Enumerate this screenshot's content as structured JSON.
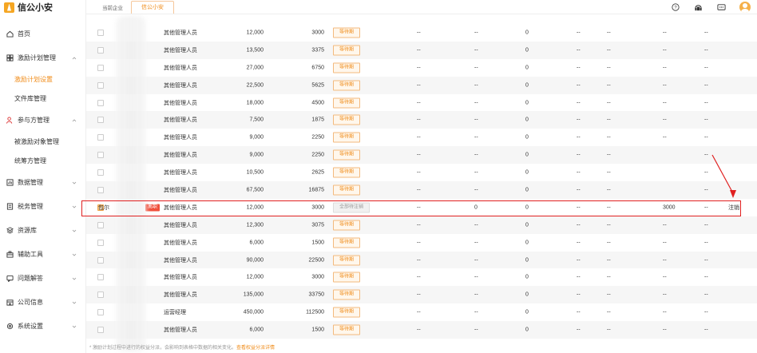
{
  "brand": {
    "name": "信公小安"
  },
  "header": {
    "company_label": "当前企业",
    "company_tab": "信公小安"
  },
  "sidebar": {
    "items": [
      {
        "label": "首页",
        "icon": "home-icon"
      },
      {
        "label": "激励计划管理",
        "icon": "chart-icon",
        "expanded": true,
        "children": [
          "激励计划设置",
          "文件库管理"
        ]
      },
      {
        "label": "参与方管理",
        "icon": "users-icon",
        "expanded": true,
        "children": [
          "被激励对象管理",
          "统筹方管理"
        ]
      },
      {
        "label": "数据管理",
        "icon": "database-icon"
      },
      {
        "label": "税务管理",
        "icon": "tax-icon"
      },
      {
        "label": "资源库",
        "icon": "resource-icon"
      },
      {
        "label": "辅助工具",
        "icon": "toolbox-icon"
      },
      {
        "label": "问题解答",
        "icon": "question-icon"
      },
      {
        "label": "公司信息",
        "icon": "company-icon"
      },
      {
        "label": "系统设置",
        "icon": "settings-icon"
      }
    ],
    "active_sub": "激励计划设置"
  },
  "table": {
    "rows": [
      {
        "pos": "其他管理人员",
        "amt": "12,000",
        "shares": "3000",
        "status": "等待期"
      },
      {
        "pos": "其他管理人员",
        "amt": "13,500",
        "shares": "3375",
        "status": "等待期"
      },
      {
        "pos": "其他管理人员",
        "amt": "27,000",
        "shares": "6750",
        "status": "等待期"
      },
      {
        "pos": "其他管理人员",
        "amt": "22,500",
        "shares": "5625",
        "status": "等待期"
      },
      {
        "pos": "其他管理人员",
        "amt": "18,000",
        "shares": "4500",
        "status": "等待期"
      },
      {
        "pos": "其他管理人员",
        "amt": "7,500",
        "shares": "1875",
        "status": "等待期"
      },
      {
        "pos": "其他管理人员",
        "amt": "9,000",
        "shares": "2250",
        "status": "等待期"
      },
      {
        "pos": "其他管理人员",
        "amt": "9,000",
        "shares": "2250",
        "status": "等待期",
        "d5": "",
        "d6": "--"
      },
      {
        "pos": "其他管理人员",
        "amt": "10,500",
        "shares": "2625",
        "status": "等待期",
        "d5": "",
        "d6": "--"
      },
      {
        "pos": "其他管理人员",
        "amt": "67,500",
        "shares": "16875",
        "status": "等待期",
        "d5": "",
        "d6": "--"
      },
      {
        "name": "包尔",
        "tag": "离职",
        "checked": true,
        "pos": "其他管理人员",
        "amt": "12,000",
        "shares": "3000",
        "status": "全部待注销",
        "gray": true,
        "d2": "0",
        "d5": "3000",
        "d6": "--",
        "action": "注销"
      },
      {
        "pos": "其他管理人员",
        "amt": "12,300",
        "shares": "3075",
        "status": "等待期"
      },
      {
        "pos": "其他管理人员",
        "amt": "6,000",
        "shares": "1500",
        "status": "等待期"
      },
      {
        "pos": "其他管理人员",
        "amt": "90,000",
        "shares": "22500",
        "status": "等待期"
      },
      {
        "pos": "其他管理人员",
        "amt": "12,000",
        "shares": "3000",
        "status": "等待期"
      },
      {
        "pos": "其他管理人员",
        "amt": "135,000",
        "shares": "33750",
        "status": "等待期"
      },
      {
        "pos": "运营经理",
        "amt": "450,000",
        "shares": "112500",
        "status": "等待期"
      },
      {
        "pos": "其他管理人员",
        "amt": "6,000",
        "shares": "1500",
        "status": "等待期"
      }
    ],
    "dash": "--",
    "zero": "0"
  },
  "footer": {
    "note": "* 激励计划过程中进行的权益分派，会影响到表格中数据的相关变化。",
    "link": "查看权益分派详情"
  }
}
